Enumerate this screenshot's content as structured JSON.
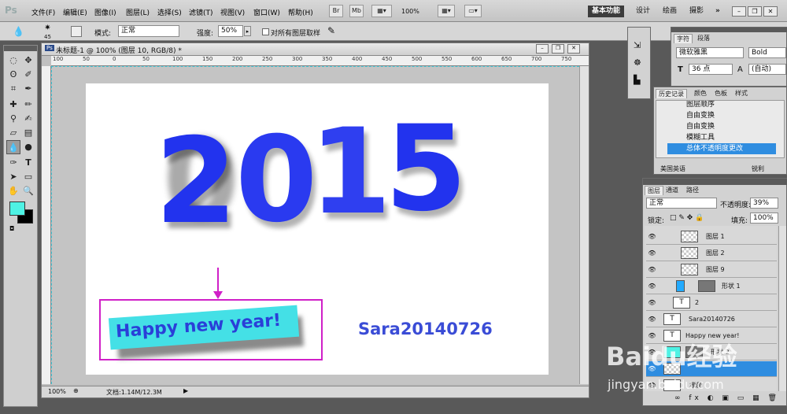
{
  "app": {
    "logo": "Ps"
  },
  "menu": [
    "文件(F)",
    "编辑(E)",
    "图像(I)",
    "图层(L)",
    "选择(S)",
    "滤镜(T)",
    "视图(V)",
    "窗口(W)",
    "帮助(H)"
  ],
  "appbar": {
    "br": "Br",
    "mb": "Mb",
    "zoom": "100%",
    "workspaces": [
      "基本功能",
      "设计",
      "绘画",
      "摄影"
    ],
    "more": "»"
  },
  "options": {
    "brush_size": "45",
    "mode_label": "模式:",
    "mode_value": "正常",
    "strength_label": "强度:",
    "strength_value": "50%",
    "sample_all": "对所有图层取样"
  },
  "document": {
    "tab_title": "未标题-1 @ 100% (图层 10, RGB/8) *",
    "zoom": "100%",
    "doc_info": "文档:1.14M/12.3M",
    "ruler_marks": [
      "100",
      "50",
      "0",
      "50",
      "100",
      "150",
      "200",
      "250",
      "300",
      "350",
      "400",
      "450",
      "500",
      "550",
      "600",
      "650",
      "700",
      "750"
    ]
  },
  "artwork": {
    "year_digits": [
      "2",
      "0",
      "1",
      "5"
    ],
    "banner": "Happy new year!",
    "author": "Sara20140726",
    "digit_color": "#2233ee",
    "banner_color": "#44e0e6",
    "frame_color": "#d020c8"
  },
  "character_panel": {
    "tabs": [
      "字符",
      "段落"
    ],
    "font": "微软雅黑",
    "style": "Bold",
    "size": "36 点",
    "leading": "(自动)"
  },
  "history_panel": {
    "tabs": [
      "历史记录",
      "颜色",
      "色板",
      "样式"
    ],
    "items": [
      {
        "label": "图层顺序",
        "selected": false
      },
      {
        "label": "自由变换",
        "selected": false
      },
      {
        "label": "自由变换",
        "selected": false
      },
      {
        "label": "模糊工具",
        "selected": false
      },
      {
        "label": "总体不透明度更改",
        "selected": true
      }
    ],
    "language": "美国英语",
    "aa": "锐利"
  },
  "layers_panel": {
    "tabs": [
      "图层",
      "通道",
      "路径"
    ],
    "blend": "正常",
    "opacity_label": "不透明度:",
    "opacity": "39%",
    "lock_label": "锁定:",
    "fill_label": "填充:",
    "fill": "100%",
    "layers": [
      {
        "name": "图层 1",
        "type": "raster"
      },
      {
        "name": "图层 2",
        "type": "raster"
      },
      {
        "name": "图层 9",
        "type": "raster"
      },
      {
        "name": "形状 1",
        "type": "shape"
      },
      {
        "name": "2",
        "type": "text"
      },
      {
        "name": "Sara20140726",
        "type": "text"
      },
      {
        "name": "Happy new year!",
        "type": "text"
      },
      {
        "name": "形状 2",
        "type": "shape"
      },
      {
        "name": "",
        "type": "raster",
        "selected": true
      },
      {
        "name": "背景",
        "type": "raster"
      }
    ]
  },
  "watermark": {
    "line1": "Baidu经验",
    "line2": "jingyan.baidu.com"
  }
}
